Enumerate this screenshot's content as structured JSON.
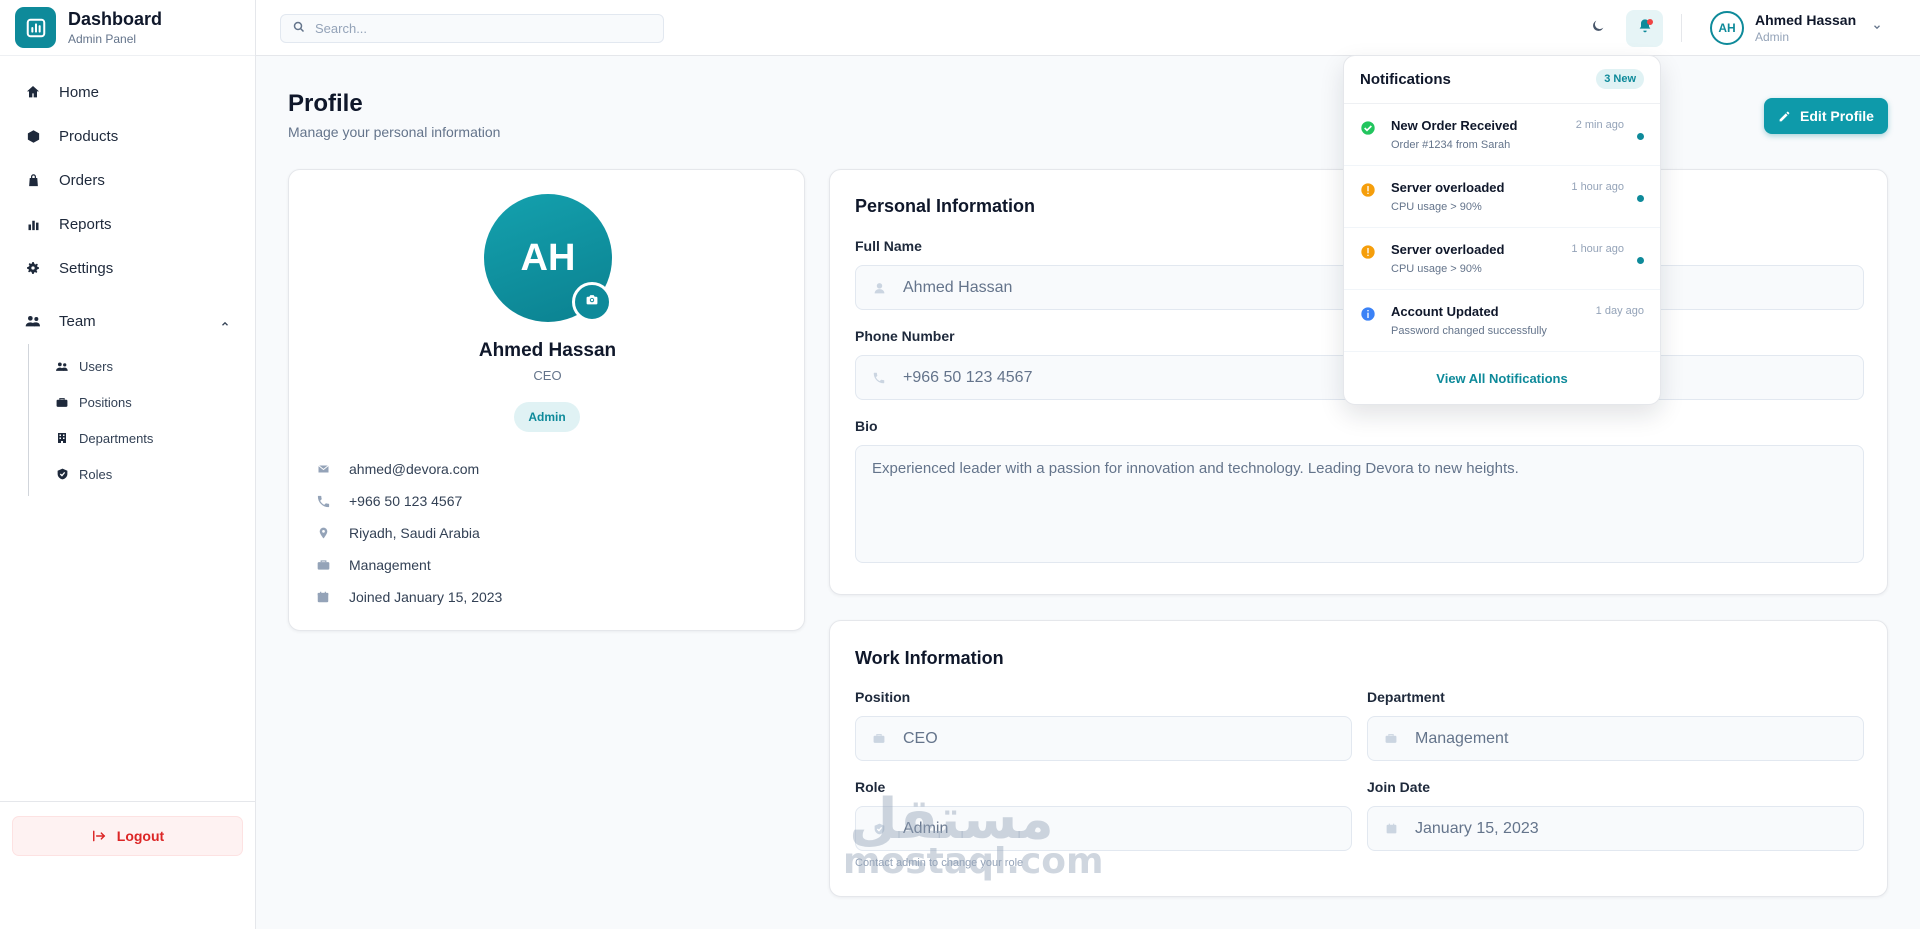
{
  "brand": {
    "title": "Dashboard",
    "subtitle": "Admin Panel"
  },
  "nav": {
    "items": [
      {
        "label": "Home",
        "icon": "home-icon"
      },
      {
        "label": "Products",
        "icon": "box-icon"
      },
      {
        "label": "Orders",
        "icon": "bag-icon"
      },
      {
        "label": "Reports",
        "icon": "bar-chart-icon"
      },
      {
        "label": "Settings",
        "icon": "gear-icon"
      }
    ],
    "team": {
      "label": "Team",
      "expanded": true,
      "items": [
        {
          "label": "Users",
          "icon": "users-icon"
        },
        {
          "label": "Positions",
          "icon": "briefcase-icon"
        },
        {
          "label": "Departments",
          "icon": "building-icon"
        },
        {
          "label": "Roles",
          "icon": "shield-check-icon"
        }
      ]
    },
    "logout_label": "Logout"
  },
  "topbar": {
    "search_placeholder": "Search...",
    "user": {
      "initials": "AH",
      "name": "Ahmed Hassan",
      "role": "Admin"
    }
  },
  "page": {
    "title": "Profile",
    "subtitle": "Manage your personal information",
    "edit_label": "Edit Profile"
  },
  "profile": {
    "initials": "AH",
    "name": "Ahmed Hassan",
    "position": "CEO",
    "badge": "Admin",
    "details": [
      {
        "icon": "mail-icon",
        "text": "ahmed@devora.com"
      },
      {
        "icon": "phone-icon",
        "text": "+966 50 123 4567"
      },
      {
        "icon": "location-icon",
        "text": "Riyadh, Saudi Arabia"
      },
      {
        "icon": "briefcase-icon",
        "text": "Management"
      },
      {
        "icon": "calendar-icon",
        "text": "Joined January 15, 2023"
      }
    ]
  },
  "personal": {
    "title": "Personal Information",
    "full_name_label": "Full Name",
    "full_name": "Ahmed Hassan",
    "phone_label": "Phone Number",
    "phone": "+966 50 123 4567",
    "bio_label": "Bio",
    "bio": "Experienced leader with a passion for innovation and technology. Leading Devora to new heights."
  },
  "work": {
    "title": "Work Information",
    "position_label": "Position",
    "position": "CEO",
    "department_label": "Department",
    "department": "Management",
    "role_label": "Role",
    "role": "Admin",
    "role_hint": "Contact admin to change your role",
    "join_label": "Join Date",
    "join_date": "January 15, 2023"
  },
  "notifications": {
    "title": "Notifications",
    "count_label": "3 New",
    "items": [
      {
        "title": "New Order Received",
        "desc": "Order #1234 from Sarah",
        "time": "2 min ago",
        "type": "success",
        "unread": true
      },
      {
        "title": "Server overloaded",
        "desc": "CPU usage > 90%",
        "time": "1 hour ago",
        "type": "warning",
        "unread": true
      },
      {
        "title": "Server overloaded",
        "desc": "CPU usage > 90%",
        "time": "1 hour ago",
        "type": "warning",
        "unread": true
      },
      {
        "title": "Account Updated",
        "desc": "Password changed successfully",
        "time": "1 day ago",
        "type": "info",
        "unread": false
      }
    ],
    "view_all": "View All Notifications"
  },
  "watermark": {
    "arabic": "مستقل",
    "latin": "mostaql.com"
  },
  "colors": {
    "accent": "#0e8a9a",
    "danger": "#dc2626",
    "success": "#22c55e",
    "warning": "#f59e0b",
    "info": "#3b82f6"
  }
}
